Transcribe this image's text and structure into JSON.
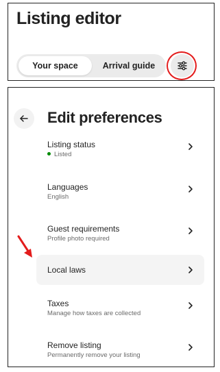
{
  "header": {
    "title": "Listing editor",
    "tabs": [
      {
        "label": "Your space",
        "active": true
      },
      {
        "label": "Arrival guide",
        "active": false
      }
    ],
    "settings_icon": "sliders-icon"
  },
  "preferences": {
    "title": "Edit preferences",
    "back_icon": "arrow-left-icon",
    "items": [
      {
        "label": "Listing status",
        "subtitle": "Listed",
        "status_color": "#008a05"
      },
      {
        "label": "Languages",
        "subtitle": "English"
      },
      {
        "label": "Guest requirements",
        "subtitle": "Profile photo required"
      },
      {
        "label": "Local laws",
        "subtitle": ""
      },
      {
        "label": "Taxes",
        "subtitle": "Manage how taxes are collected"
      },
      {
        "label": "Remove listing",
        "subtitle": "Permanently remove your listing"
      }
    ]
  },
  "annotations": {
    "color": "#e31c1c"
  }
}
